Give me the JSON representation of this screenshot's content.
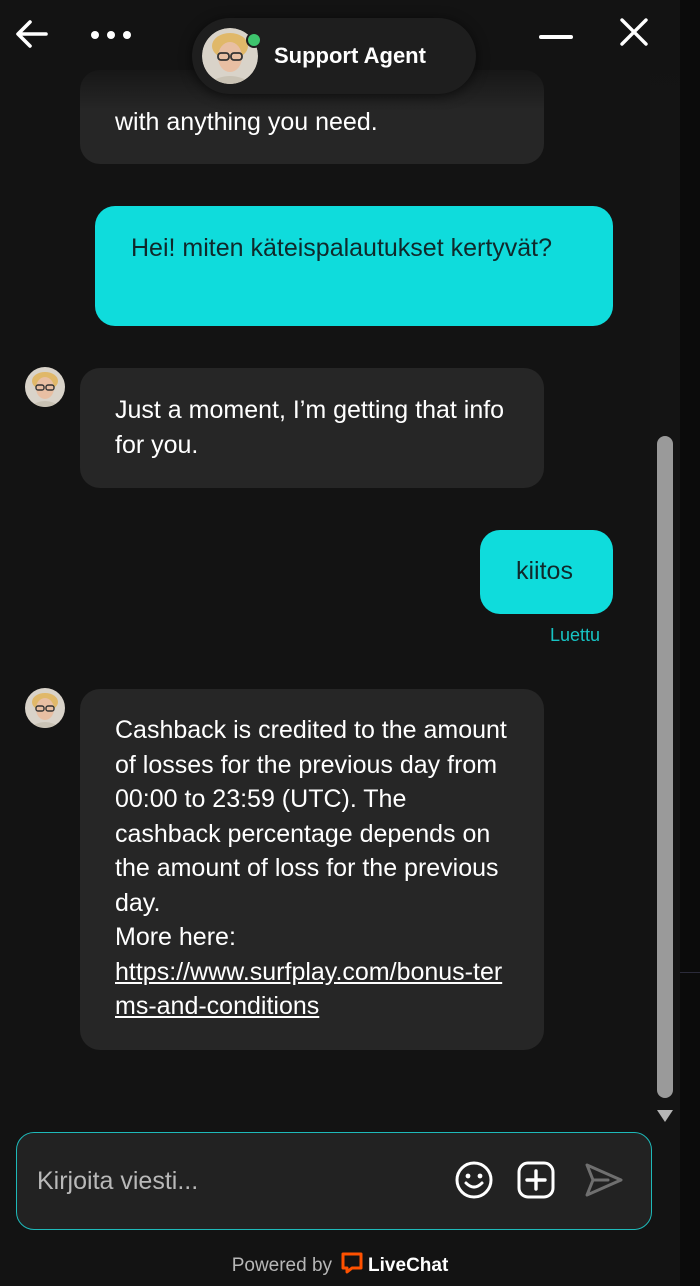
{
  "header": {
    "agent_name": "Support Agent",
    "status": "online"
  },
  "messages": [
    {
      "from": "agent",
      "text": "with anything you need."
    },
    {
      "from": "user",
      "text": "Hei! miten käteispalautukset kertyvät?"
    },
    {
      "from": "agent",
      "text": "Just a moment, I’m getting that info for you."
    },
    {
      "from": "user",
      "text": "kiitos",
      "status": "Luettu"
    },
    {
      "from": "agent",
      "text": "Cashback is credited to the amount of losses for the previous day from 00:00 to 23:59 (UTC). The cashback percentage depends on the amount of loss for the previous day.",
      "more_label": "More here:",
      "link": "https://www.surfplay.com/bonus-terms-and-conditions"
    }
  ],
  "composer": {
    "placeholder": "Kirjoita viesti..."
  },
  "footer": {
    "powered_by": "Powered by",
    "brand": "LiveChat"
  },
  "colors": {
    "accent": "#0fdcdc",
    "background": "#131313",
    "agent_bubble": "#262626",
    "online": "#3ec46d",
    "brand_orange": "#ff5100"
  },
  "icons": {
    "back": "arrow-left-icon",
    "more": "more-horizontal-icon",
    "minimize": "minimize-icon",
    "close": "close-icon",
    "emoji": "emoji-icon",
    "attach": "attachment-plus-icon",
    "send": "send-icon"
  }
}
